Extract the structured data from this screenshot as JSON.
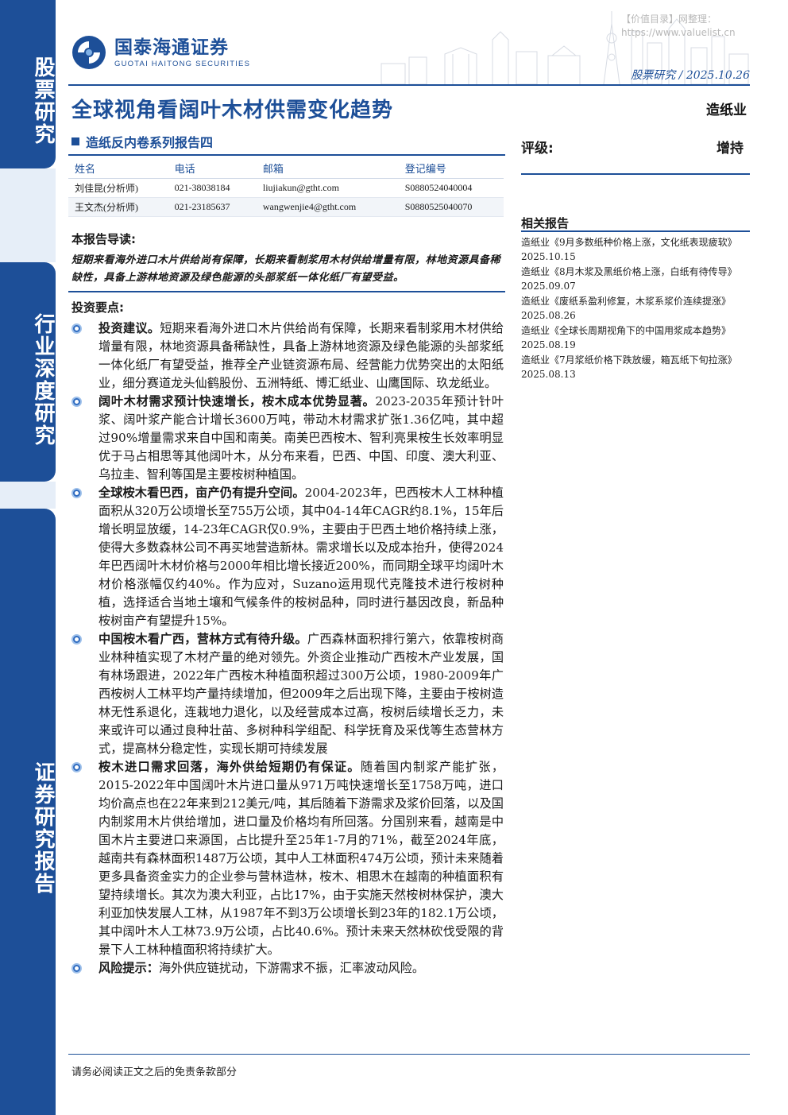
{
  "side_tabs": [
    "股票研究",
    "行业深度研究",
    "证券研究报告"
  ],
  "header": {
    "company_cn": "国泰海通证券",
    "company_en": "GUOTAI HAITONG SECURITIES",
    "watermark_line1": "【价值目录】网整理：",
    "watermark_line2": "https://www.valuelist.cn",
    "report_meta": "股票研究 / 2025.10.26"
  },
  "title": "全球视角看阔叶木材供需变化趋势",
  "industry": "造纸业",
  "series": "造纸反内卷系列报告四",
  "rating": {
    "label": "评级:",
    "value": "增持"
  },
  "analysts": {
    "headers": [
      "姓名",
      "电话",
      "邮箱",
      "登记编号"
    ],
    "rows": [
      [
        "刘佳昆(分析师)",
        "021-38038184",
        "liujiakun@gtht.com",
        "S0880524040004"
      ],
      [
        "王文杰(分析师)",
        "021-23185637",
        "wangwenjie4@gtht.com",
        "S0880525040070"
      ]
    ]
  },
  "related": {
    "title": "相关报告",
    "items": [
      "造纸业《9月多数纸种价格上涨，文化纸表现疲软》2025.10.15",
      "造纸业《8月木浆及黑纸价格上涨，白纸有待传导》2025.09.07",
      "造纸业《废纸系盈利修复，木浆系浆价连续提涨》2025.08.26",
      "造纸业《全球长周期视角下的中国用浆成本趋势》2025.08.19",
      "造纸业《7月浆纸价格下跌放缓，箱瓦纸下旬拉涨》2025.08.13"
    ]
  },
  "guide": {
    "heading": "本报告导读:",
    "text": "短期来看海外进口木片供给尚有保障，长期来看制浆用木材供给增量有限，林地资源具备稀缺性，具备上游林地资源及绿色能源的头部浆纸一体化纸厂有望受益。"
  },
  "points": {
    "heading": "投资要点:",
    "items": [
      {
        "lead": "投资建议。",
        "text": "短期来看海外进口木片供给尚有保障，长期来看制浆用木材供给增量有限，林地资源具备稀缺性，具备上游林地资源及绿色能源的头部浆纸一体化纸厂有望受益，推荐全产业链资源布局、经营能力优势突出的太阳纸业，细分赛道龙头仙鹤股份、五洲特纸、博汇纸业、山鹰国际、玖龙纸业。"
      },
      {
        "lead": "阔叶木材需求预计快速增长，桉木成本优势显著。",
        "text": "2023-2035年预计针叶浆、阔叶浆产能合计增长3600万吨，带动木材需求扩张1.36亿吨，其中超过90%增量需求来自中国和南美。南美巴西桉木、智利亮果桉生长效率明显优于马占相思等其他阔叶木，从分布来看，巴西、中国、印度、澳大利亚、乌拉圭、智利等国是主要桉树种植国。"
      },
      {
        "lead": "全球桉木看巴西，亩产仍有提升空间。",
        "text": "2004-2023年，巴西桉木人工林种植面积从320万公顷增长至755万公顷，其中04-14年CAGR约8.1%，15年后增长明显放缓，14-23年CAGR仅0.9%，主要由于巴西土地价格持续上涨，使得大多数森林公司不再买地营造新林。需求增长以及成本抬升，使得2024年巴西阔叶木材价格与2000年相比增长接近200%，而同期全球平均阔叶木材价格涨幅仅约40%。作为应对，Suzano运用现代克隆技术进行桉树种植，选择适合当地土壤和气候条件的桉树品种，同时进行基因改良，新品种桉树亩产有望提升15%。"
      },
      {
        "lead": "中国桉木看广西，营林方式有待升级。",
        "text": "广西森林面积排行第六，依靠桉树商业林种植实现了木材产量的绝对领先。外资企业推动广西桉木产业发展，国有林场跟进，2022年广西桉木种植面积超过300万公顷，1980-2009年广西桉树人工林平均产量持续增加，但2009年之后出现下降，主要由于桉树造林无性系退化，连栽地力退化，以及经营成本过高，桉树后续增长乏力，未来或许可以通过良种壮苗、多树种科学组配、科学抚育及采伐等生态营林方式，提高林分稳定性，实现长期可持续发展"
      },
      {
        "lead": "桉木进口需求回落，海外供给短期仍有保证。",
        "text": "随着国内制浆产能扩张，2015-2022年中国阔叶木片进口量从971万吨快速增长至1758万吨，进口均价高点也在22年来到212美元/吨，其后随着下游需求及浆价回落，以及国内制浆用木片供给增加，进口量及价格均有所回落。分国别来看，越南是中国木片主要进口来源国，占比提升至25年1-7月的71%，截至2024年底，越南共有森林面积1487万公顷，其中人工林面积474万公顷，预计未来随着更多具备资金实力的企业参与营林造林，桉木、相思木在越南的种植面积有望持续增长。其次为澳大利亚，占比17%，由于实施天然桉树林保护，澳大利亚加快发展人工林，从1987年不到3万公顷增长到23年的182.1万公顷，其中阔叶木人工林73.9万公顷，占比40.6%。预计未来天然林砍伐受限的背景下人工林种植面积将持续扩大。"
      },
      {
        "lead": "风险提示：",
        "text": "海外供应链扰动，下游需求不振，汇率波动风险。"
      }
    ]
  },
  "footer": "请务必阅读正文之后的免责条款部分",
  "colors": {
    "brand": "#1d4f98",
    "bullet": "#2f6bc0"
  }
}
